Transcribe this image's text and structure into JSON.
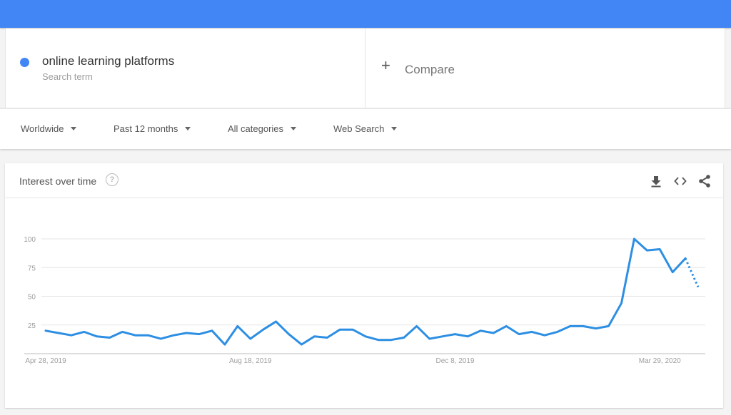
{
  "header": {
    "brand_color": "#4285f4"
  },
  "search_term": {
    "name": "online learning platforms",
    "sublabel": "Search term",
    "color": "#4285f4"
  },
  "compare": {
    "icon": "plus-icon",
    "label": "Compare"
  },
  "filters": [
    {
      "label": "Worldwide"
    },
    {
      "label": "Past 12 months"
    },
    {
      "label": "All categories"
    },
    {
      "label": "Web Search"
    }
  ],
  "card": {
    "title": "Interest over time",
    "help_icon": "help-circle-icon",
    "actions": [
      "download-icon",
      "embed-code-icon",
      "share-icon"
    ]
  },
  "chart_data": {
    "type": "line",
    "title": "Interest over time",
    "xlabel": "",
    "ylabel": "",
    "ylim": [
      0,
      100
    ],
    "yticks": [
      25,
      50,
      75,
      100
    ],
    "xtick_labels": [
      {
        "label": "Apr 28, 2019",
        "index": 0
      },
      {
        "label": "Aug 18, 2019",
        "index": 16
      },
      {
        "label": "Dec 8, 2019",
        "index": 32
      },
      {
        "label": "Mar 29, 2020",
        "index": 48
      }
    ],
    "grid": true,
    "legend": "none",
    "series": [
      {
        "name": "online learning platforms",
        "color": "#2d8fe3",
        "values": [
          20,
          18,
          16,
          19,
          15,
          14,
          19,
          16,
          16,
          13,
          16,
          18,
          17,
          20,
          8,
          24,
          13,
          21,
          28,
          17,
          8,
          15,
          14,
          21,
          21,
          15,
          12,
          12,
          14,
          24,
          13,
          15,
          17,
          15,
          20,
          18,
          24,
          17,
          19,
          16,
          19,
          24,
          24,
          22,
          24,
          44,
          100,
          90,
          91,
          71,
          83,
          58
        ],
        "partial_from_index": 50
      }
    ]
  }
}
